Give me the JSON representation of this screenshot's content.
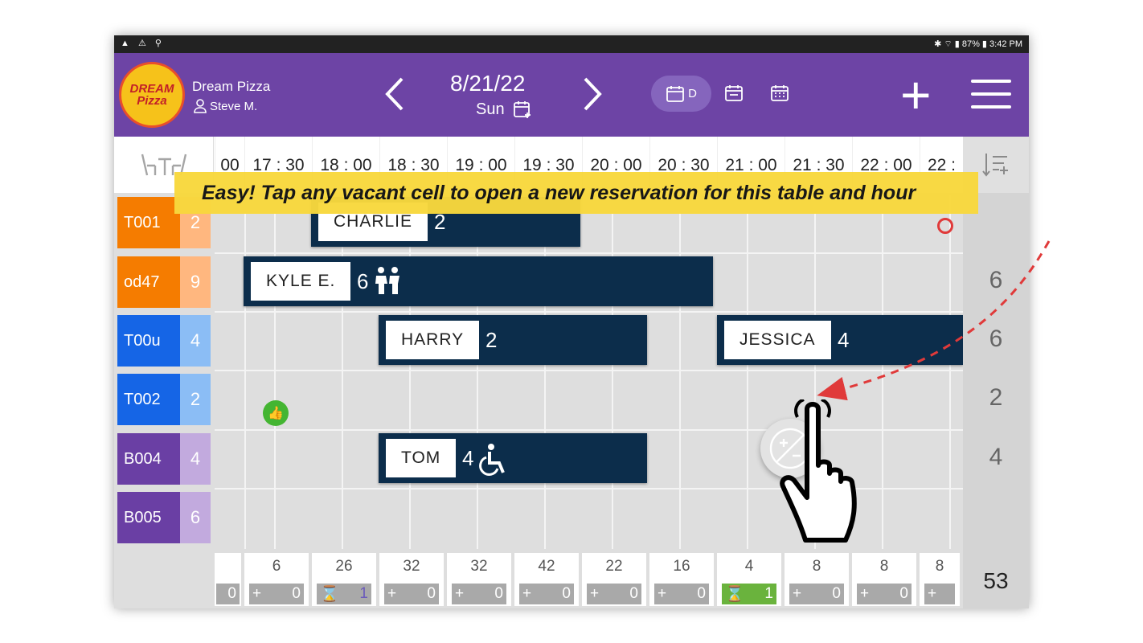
{
  "status_bar": {
    "left_icons": "▲ ⚠ ⚲",
    "right_text": "✱ ⌔ ▮ 87% ▮ 3:42 PM"
  },
  "restaurant": {
    "name": "Dream Pizza",
    "user": "Steve M.",
    "logo_line1": "DREAM",
    "logo_line2": "Pizza"
  },
  "nav": {
    "prev_icon": "chevron-left",
    "next_icon": "chevron-right",
    "date": "8/21/22",
    "weekday": "Sun"
  },
  "views": {
    "day_label": "D",
    "day_icon": "calendar-day",
    "week_icon": "calendar-week",
    "month_icon": "calendar-month"
  },
  "toolbar": {
    "add_label": "+",
    "menu_icon": "hamburger"
  },
  "header": {
    "table_icon": "table-chairs",
    "sort_icon": "sort-add",
    "times": [
      "00",
      "17 : 30",
      "18 : 00",
      "18 : 30",
      "19 : 00",
      "19 : 30",
      "20 : 00",
      "20 : 30",
      "21 : 00",
      "21 : 30",
      "22 : 00",
      "22 :"
    ]
  },
  "tables": [
    {
      "name": "T001",
      "capacity": "2",
      "color": "#f57c00",
      "cap_color": "#ffb77f"
    },
    {
      "name": "od47",
      "capacity": "9",
      "color": "#f57c00",
      "cap_color": "#ffb77f"
    },
    {
      "name": "T00u",
      "capacity": "4",
      "color": "#1565e6",
      "cap_color": "#8bbdf5"
    },
    {
      "name": "T002",
      "capacity": "2",
      "color": "#1565e6",
      "cap_color": "#8bbdf5"
    },
    {
      "name": "B004",
      "capacity": "4",
      "color": "#6a3fa4",
      "cap_color": "#c2aade"
    },
    {
      "name": "B005",
      "capacity": "6",
      "color": "#6a3fa4",
      "cap_color": "#c2aade"
    }
  ],
  "row_totals": [
    "",
    "6",
    "6",
    "2",
    "4",
    ""
  ],
  "reservations": [
    {
      "row": 0,
      "name": "CHARLIE",
      "size": "2",
      "icon": ""
    },
    {
      "row": 1,
      "name": "KYLE E.",
      "size": "6",
      "icon": "children"
    },
    {
      "row": 2,
      "name": "HARRY",
      "size": "2",
      "icon": ""
    },
    {
      "row": 2,
      "name": "JESSICA",
      "size": "4",
      "icon": ""
    },
    {
      "row": 4,
      "name": "TOM",
      "size": "4",
      "icon": "wheelchair"
    }
  ],
  "banner": {
    "text": "Easy! Tap any vacant cell to open a new reservation for this table and hour"
  },
  "footer": {
    "counts": [
      "",
      "6",
      "26",
      "32",
      "32",
      "42",
      "22",
      "16",
      "4",
      "8",
      "8",
      "8"
    ],
    "bars": [
      {
        "left": "",
        "right": "0",
        "type": "plus"
      },
      {
        "left": "+",
        "right": "0",
        "type": "plus"
      },
      {
        "left": "⌛",
        "right": "1",
        "type": "wait"
      },
      {
        "left": "+",
        "right": "0",
        "type": "plus"
      },
      {
        "left": "+",
        "right": "0",
        "type": "plus"
      },
      {
        "left": "+",
        "right": "0",
        "type": "plus"
      },
      {
        "left": "+",
        "right": "0",
        "type": "plus"
      },
      {
        "left": "+",
        "right": "0",
        "type": "plus"
      },
      {
        "left": "⌛",
        "right": "1",
        "type": "wait-active"
      },
      {
        "left": "+",
        "right": "0",
        "type": "plus"
      },
      {
        "left": "+",
        "right": "0",
        "type": "plus"
      },
      {
        "left": "+",
        "right": "",
        "type": "plus"
      }
    ],
    "total": "53"
  },
  "colors": {
    "appbar": "#6d44a5",
    "reservation": "#0c2d4b",
    "banner": "#f8d83d",
    "arrow": "#e03a3a",
    "wait_active": "#6ab33d"
  }
}
